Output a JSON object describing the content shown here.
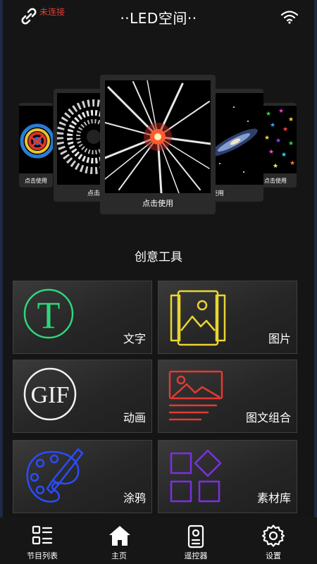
{
  "header": {
    "connection_status": "未连接",
    "title": "··LED空间··"
  },
  "carousel": {
    "cards": [
      {
        "caption": "点击使用"
      },
      {
        "caption": "点击"
      },
      {
        "caption": "点击使用"
      },
      {
        "caption": "使用"
      },
      {
        "caption": "点击使用"
      }
    ]
  },
  "creative_tools": {
    "title": "创意工具",
    "items": [
      {
        "label": "文字"
      },
      {
        "label": "图片"
      },
      {
        "label": "动画"
      },
      {
        "label": "图文组合"
      },
      {
        "label": "涂鸦"
      },
      {
        "label": "素材库"
      }
    ]
  },
  "nav": {
    "items": [
      {
        "label": "节目列表"
      },
      {
        "label": "主页"
      },
      {
        "label": "遥控器"
      },
      {
        "label": "设置"
      }
    ]
  },
  "colors": {
    "status_red": "#e53b2f",
    "neon_green": "#2fd67a",
    "neon_yellow": "#e9d531",
    "neon_white": "#f2f2f2",
    "neon_red": "#e33a33",
    "neon_blue": "#2b4cff",
    "neon_purple": "#7b2fe6"
  },
  "icons": {
    "header_left": "link-icon",
    "header_right": "wifi-icon",
    "tool_text": "letter-t-icon",
    "tool_image": "image-icon",
    "tool_animation": "gif-icon",
    "tool_combo": "image-text-icon",
    "tool_doodle": "palette-icon",
    "tool_library": "shapes-grid-icon",
    "nav_list": "program-list-icon",
    "nav_home": "home-icon",
    "nav_remote": "remote-icon",
    "nav_settings": "gear-icon"
  }
}
